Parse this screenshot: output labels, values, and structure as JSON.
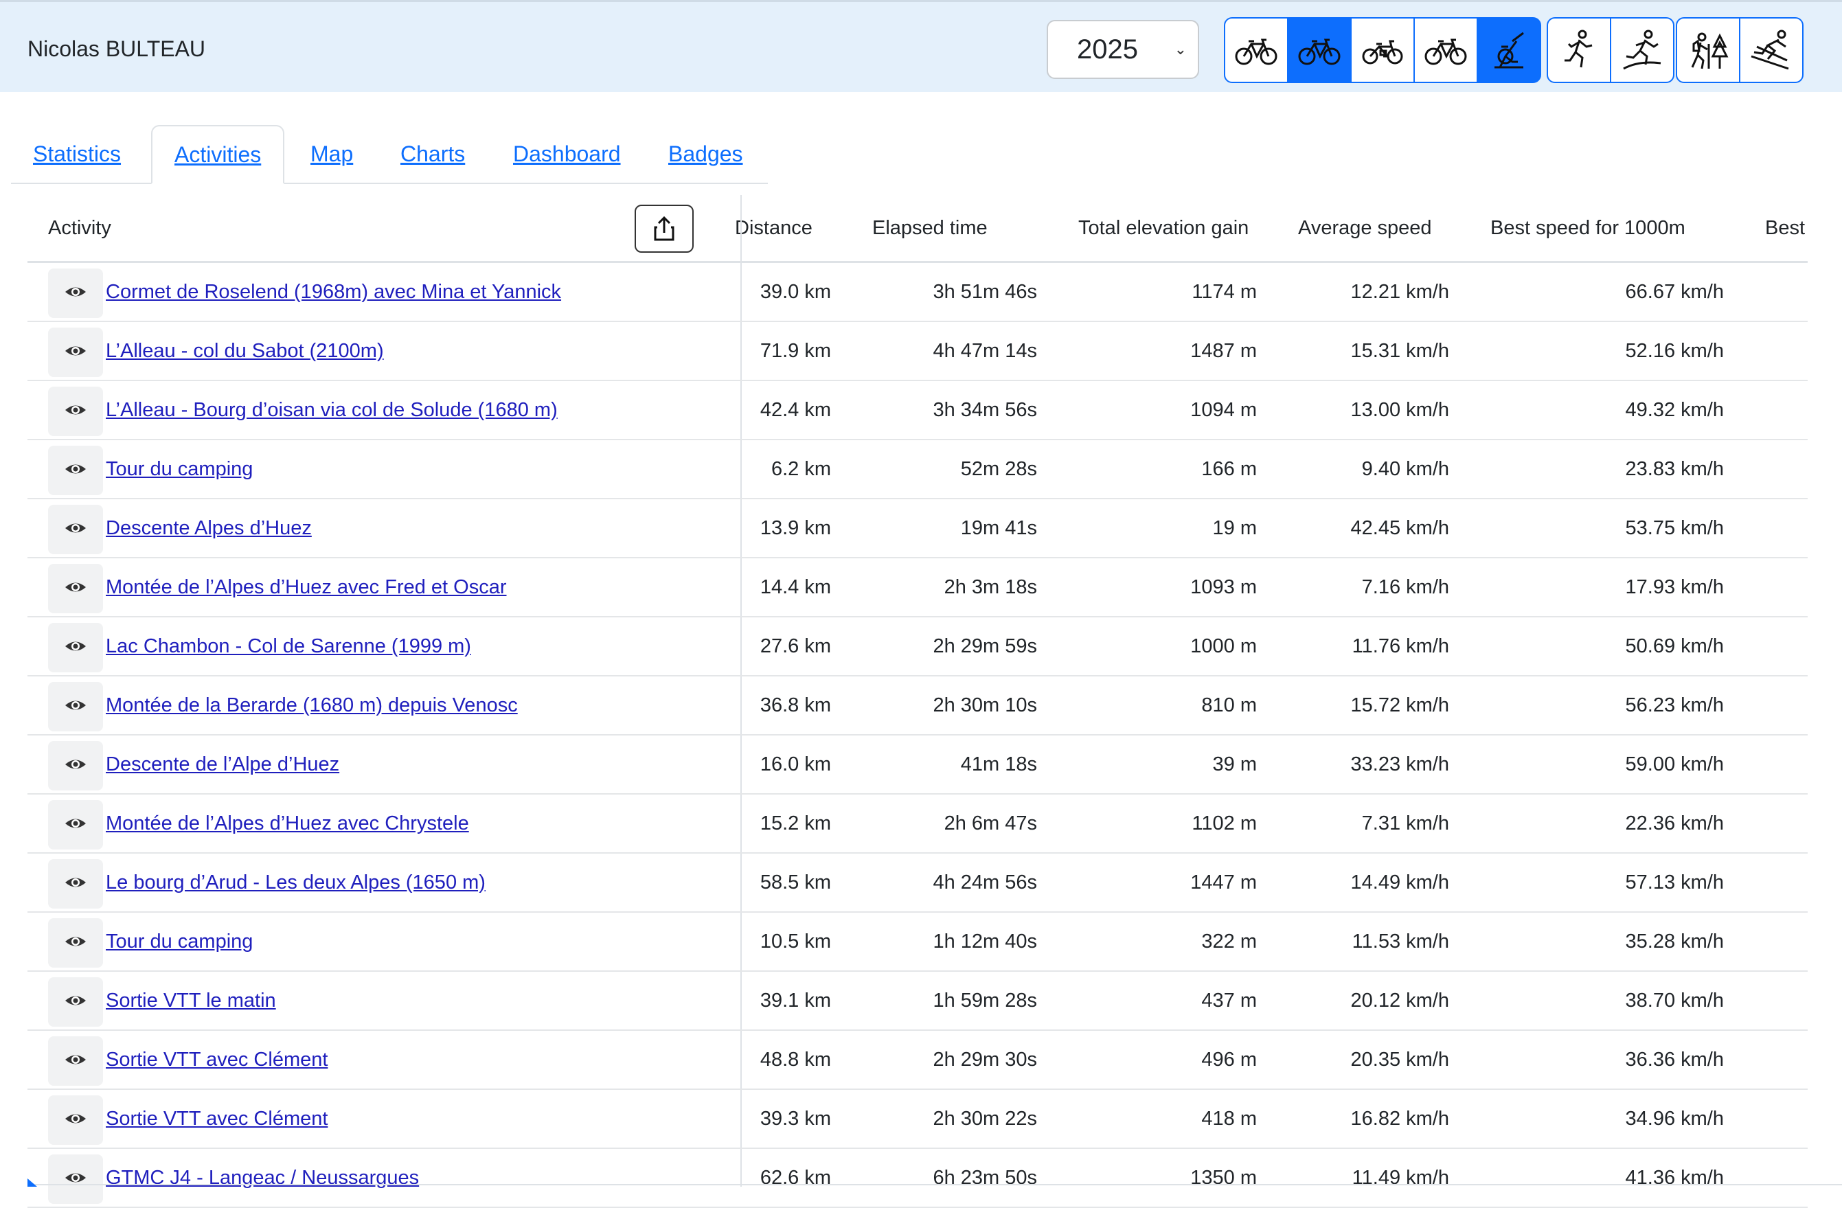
{
  "header": {
    "user_name": "Nicolas BULTEAU",
    "year": "2025",
    "activity_types": [
      {
        "icon": "road-bike-icon",
        "active": false
      },
      {
        "icon": "mountain-bike-icon",
        "active": true
      },
      {
        "icon": "e-bike-icon",
        "active": false
      },
      {
        "icon": "gravel-bike-icon",
        "active": false
      },
      {
        "icon": "stationary-bike-icon",
        "active": true
      },
      {
        "icon": "running-icon",
        "active": false
      },
      {
        "icon": "trail-running-icon",
        "active": false
      },
      {
        "icon": "hiking-icon",
        "active": false
      },
      {
        "icon": "skiing-icon",
        "active": false
      }
    ]
  },
  "tabs": [
    "Statistics",
    "Activities",
    "Map",
    "Charts",
    "Dashboard",
    "Badges"
  ],
  "active_tab": "Activities",
  "table": {
    "headers": {
      "activity": "Activity",
      "distance": "Distance",
      "elapsed": "Elapsed time",
      "elevation": "Total elevation gain",
      "avg_speed": "Average speed",
      "best_1000": "Best speed for 1000m",
      "best_more": "Best"
    },
    "rows": [
      {
        "name": "Cormet de Roselend (1968m) avec Mina et Yannick",
        "distance": "39.0 km",
        "elapsed": "3h 51m 46s",
        "elevation": "1174 m",
        "avg_speed": "12.21 km/h",
        "best_1000": "66.67 km/h"
      },
      {
        "name": "L’Alleau - col du Sabot (2100m)",
        "distance": "71.9 km",
        "elapsed": "4h 47m 14s",
        "elevation": "1487 m",
        "avg_speed": "15.31 km/h",
        "best_1000": "52.16 km/h"
      },
      {
        "name": "L’Alleau - Bourg d’oisan via col de Solude (1680 m)",
        "distance": "42.4 km",
        "elapsed": "3h 34m 56s",
        "elevation": "1094 m",
        "avg_speed": "13.00 km/h",
        "best_1000": "49.32 km/h"
      },
      {
        "name": "Tour du camping",
        "distance": "6.2 km",
        "elapsed": "52m 28s",
        "elevation": "166 m",
        "avg_speed": "9.40 km/h",
        "best_1000": "23.83 km/h"
      },
      {
        "name": "Descente Alpes d’Huez",
        "distance": "13.9 km",
        "elapsed": "19m 41s",
        "elevation": "19 m",
        "avg_speed": "42.45 km/h",
        "best_1000": "53.75 km/h"
      },
      {
        "name": "Montée de l’Alpes d’Huez avec Fred et Oscar",
        "distance": "14.4 km",
        "elapsed": "2h 3m 18s",
        "elevation": "1093 m",
        "avg_speed": "7.16 km/h",
        "best_1000": "17.93 km/h"
      },
      {
        "name": "Lac Chambon - Col de Sarenne (1999 m)",
        "distance": "27.6 km",
        "elapsed": "2h 29m 59s",
        "elevation": "1000 m",
        "avg_speed": "11.76 km/h",
        "best_1000": "50.69 km/h"
      },
      {
        "name": "Montée de la Berarde (1680 m) depuis Venosc",
        "distance": "36.8 km",
        "elapsed": "2h 30m 10s",
        "elevation": "810 m",
        "avg_speed": "15.72 km/h",
        "best_1000": "56.23 km/h"
      },
      {
        "name": "Descente de l’Alpe d’Huez",
        "distance": "16.0 km",
        "elapsed": "41m 18s",
        "elevation": "39 m",
        "avg_speed": "33.23 km/h",
        "best_1000": "59.00 km/h"
      },
      {
        "name": "Montée de l’Alpes d’Huez avec Chrystele",
        "distance": "15.2 km",
        "elapsed": "2h 6m 47s",
        "elevation": "1102 m",
        "avg_speed": "7.31 km/h",
        "best_1000": "22.36 km/h"
      },
      {
        "name": "Le bourg d’Arud - Les deux Alpes (1650 m)",
        "distance": "58.5 km",
        "elapsed": "4h 24m 56s",
        "elevation": "1447 m",
        "avg_speed": "14.49 km/h",
        "best_1000": "57.13 km/h"
      },
      {
        "name": "Tour du camping",
        "distance": "10.5 km",
        "elapsed": "1h 12m 40s",
        "elevation": "322 m",
        "avg_speed": "11.53 km/h",
        "best_1000": "35.28 km/h"
      },
      {
        "name": "Sortie VTT le matin",
        "distance": "39.1 km",
        "elapsed": "1h 59m 28s",
        "elevation": "437 m",
        "avg_speed": "20.12 km/h",
        "best_1000": "38.70 km/h"
      },
      {
        "name": "Sortie VTT avec Clément",
        "distance": "48.8 km",
        "elapsed": "2h 29m 30s",
        "elevation": "496 m",
        "avg_speed": "20.35 km/h",
        "best_1000": "36.36 km/h"
      },
      {
        "name": "Sortie VTT avec Clément",
        "distance": "39.3 km",
        "elapsed": "2h 30m 22s",
        "elevation": "418 m",
        "avg_speed": "16.82 km/h",
        "best_1000": "34.96 km/h"
      },
      {
        "name": "GTMC J4 - Langeac / Neussargues",
        "distance": "62.6 km",
        "elapsed": "6h 23m 50s",
        "elevation": "1350 m",
        "avg_speed": "11.49 km/h",
        "best_1000": "41.36 km/h"
      }
    ]
  },
  "colors": {
    "accent": "#0d6efd",
    "header_bg": "#e4f0fb",
    "link": "#1f1fbd"
  }
}
